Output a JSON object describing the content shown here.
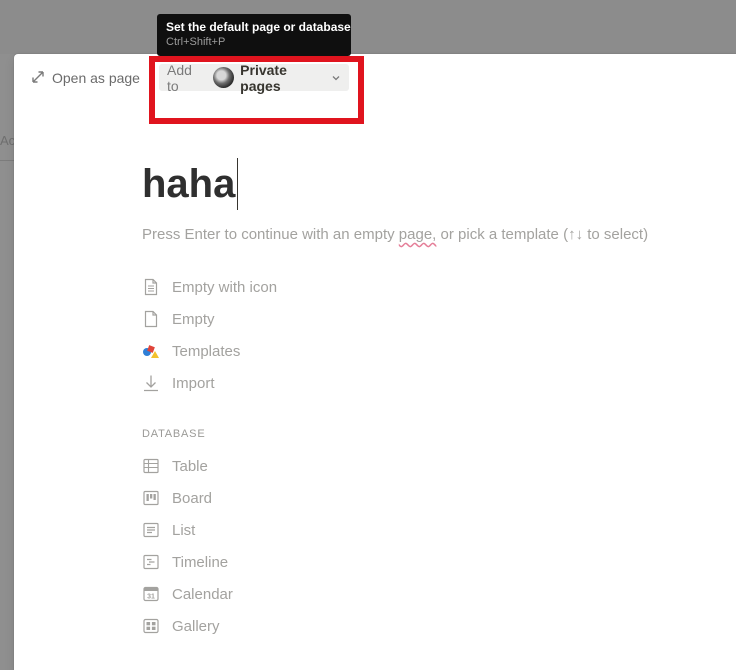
{
  "backdrop": {
    "partial_text": "Ac"
  },
  "topbar": {
    "open_as_page": "Open as page",
    "add_to_label": "Add to",
    "workspace": "Private pages"
  },
  "tooltip": {
    "title": "Set the default page or database",
    "shortcut": "Ctrl+Shift+P"
  },
  "page": {
    "title": "haha",
    "hint_before": "Press Enter to continue with an empty ",
    "hint_squiggle": "page,",
    "hint_after": " or pick a template (↑↓ to select)"
  },
  "templates": [
    {
      "label": "Empty with icon",
      "icon": "page-with-lines-icon"
    },
    {
      "label": "Empty",
      "icon": "blank-page-icon"
    },
    {
      "label": "Templates",
      "icon": "shapes-icon"
    },
    {
      "label": "Import",
      "icon": "download-arrow-icon"
    }
  ],
  "database_section": {
    "label": "DATABASE",
    "items": [
      {
        "label": "Table",
        "icon": "table-icon"
      },
      {
        "label": "Board",
        "icon": "board-icon"
      },
      {
        "label": "List",
        "icon": "list-icon"
      },
      {
        "label": "Timeline",
        "icon": "timeline-icon"
      },
      {
        "label": "Calendar",
        "icon": "calendar-icon"
      },
      {
        "label": "Gallery",
        "icon": "gallery-icon"
      }
    ]
  },
  "colors": {
    "highlight": "#e0141e",
    "tooltip_bg": "#0f0f0f",
    "muted_text": "#a3a29f"
  }
}
